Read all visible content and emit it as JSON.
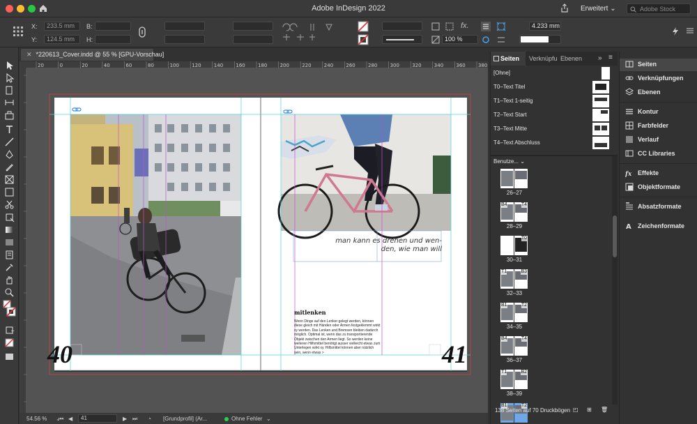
{
  "titlebar": {
    "title": "Adobe InDesign 2022",
    "workspace": "Erweitert",
    "search_placeholder": "Adobe Stock"
  },
  "control": {
    "x_label": "X:",
    "x_value": "233.5 mm",
    "y_label": "Y:",
    "y_value": "124.5 mm",
    "b_label": "B:",
    "h_label": "H:",
    "zoom_pct": "100 %",
    "stroke_value": "4.233 mm"
  },
  "document": {
    "tab_title": "*220613_Cover.indd @ 55 % [GPU-Vorschau]",
    "ruler_labels": [
      "20",
      "0",
      "20",
      "40",
      "60",
      "80",
      "100",
      "120",
      "140",
      "160",
      "180",
      "200",
      "220",
      "240",
      "260",
      "280",
      "300",
      "320",
      "340",
      "360",
      "380",
      "400"
    ],
    "left_page_number": "40",
    "right_page_number": "41",
    "pull_quote_line1": "man kann es drehen und wen-",
    "pull_quote_line2": "den, wie man will",
    "body_heading": "mitlenken",
    "body_text": "Wenn Dinge auf den Lenker gelegt werden, können diese gleich mit Händen oder Armen festgeklemmt wirkt xy werden. Das Lenken und Bremsen bleiben dadurch möglich. Optimal ist, wenn das zu transportierende Objekt zwischen den Armen liegt. So werden keine weiteren Hilfsmittel benötigt ausser vielleicht etwas zum Unterlegen wirkt xy. Hilfsmittel können aber nützlich sein, wenn etwas >"
  },
  "status": {
    "zoom": "54.56 %",
    "page": "41",
    "profile": "[Grundprofil] (Ar...",
    "errors": "Ohne Fehler"
  },
  "pages_panel": {
    "tabs": [
      "Seiten",
      "Verknüpfu",
      "Ebenen"
    ],
    "masters": [
      "[Ohne]",
      "T0–Text Titel",
      "T1–Text 1-seitig",
      "T2–Text Start",
      "T3–Text Mitte",
      "T4–Text Abschluss"
    ],
    "custom_label": "Benutze...",
    "spreads": [
      {
        "label": "26–27"
      },
      {
        "label": "28–29",
        "left_master": "B4",
        "right_master": "T4"
      },
      {
        "label": "30–31",
        "right_master": "T0"
      },
      {
        "label": "32–33",
        "left_master": "T1",
        "right_master": "B3"
      },
      {
        "label": "34–35",
        "left_master": "B1",
        "right_master": "T2"
      },
      {
        "label": "36–37",
        "left_master": "B4",
        "right_master": "T4"
      },
      {
        "label": "38–39",
        "left_master": "T1",
        "right_master": "B2"
      },
      {
        "label": "40–41",
        "left_master": "B1",
        "right_master": "T2"
      }
    ],
    "footer": "138 Seiten auf 70 Druckbögen"
  },
  "dock": {
    "items": [
      "Seiten",
      "Verknüpfungen",
      "Ebenen",
      "Kontur",
      "Farbfelder",
      "Verlauf",
      "CC Libraries",
      "Effekte",
      "Objektformate",
      "Absatzformate",
      "Zeichenformate"
    ]
  },
  "colors": {
    "accent": "#2a7bd6",
    "guide_cyan": "#4fd0e0",
    "margin_magenta": "#c04fd0",
    "bleed_red": "#d04040"
  }
}
